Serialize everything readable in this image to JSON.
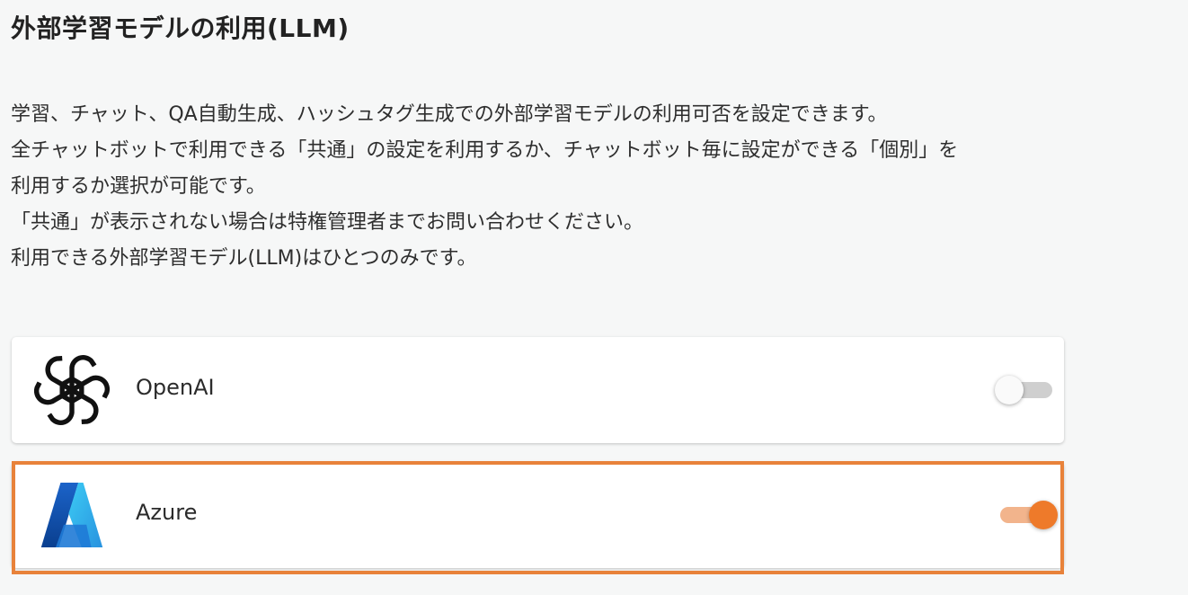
{
  "page": {
    "title": "外部学習モデルの利用(LLM)",
    "description": [
      "学習、チャット、QA自動生成、ハッシュタグ生成での外部学習モデルの利用可否を設定できます。",
      "全チャットボットで利用できる「共通」の設定を利用するか、チャットボット毎に設定ができる「個別」を",
      "利用するか選択が可能です。",
      "「共通」が表示されない場合は特権管理者までお問い合わせください。",
      "利用できる外部学習モデル(LLM)はひとつのみです。"
    ]
  },
  "providers": [
    {
      "name": "OpenAI",
      "icon": "openai-logo-icon",
      "enabled": false
    },
    {
      "name": "Azure",
      "icon": "azure-logo-icon",
      "enabled": true
    }
  ],
  "colors": {
    "accent": "#ee7a2a",
    "accent_track": "#f2b48c",
    "highlight_border": "#e8823a",
    "toggle_off_track": "#cfcfcf",
    "background": "#f6f7f7"
  }
}
